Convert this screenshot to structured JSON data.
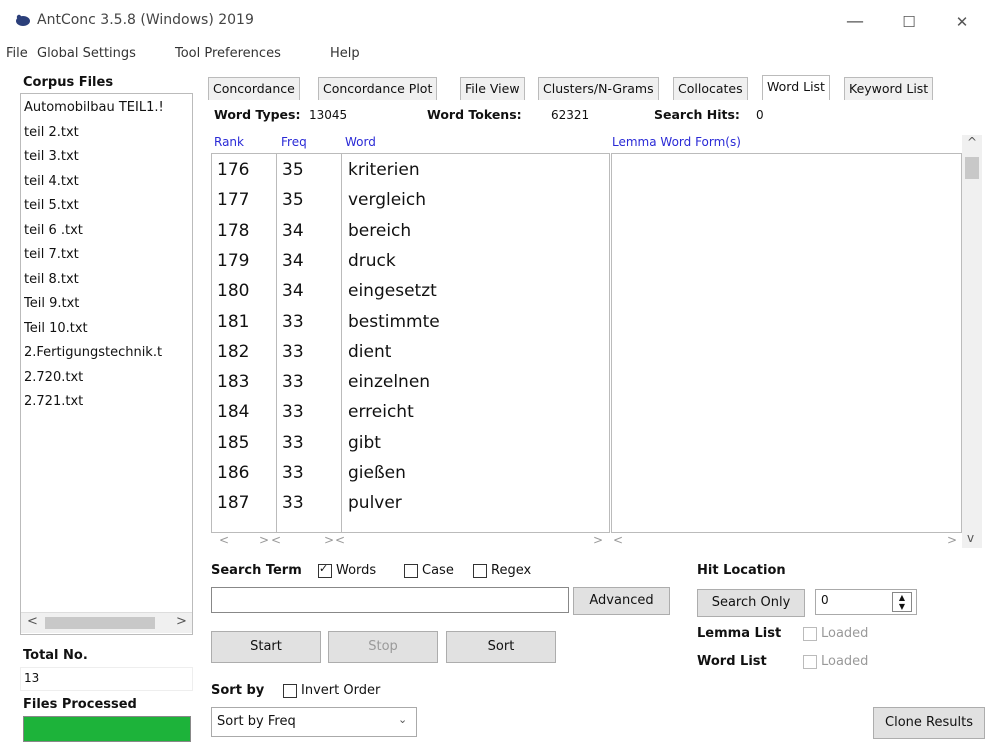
{
  "window": {
    "title": "AntConc 3.5.8 (Windows) 2019",
    "minimize": "—",
    "maximize": "☐",
    "close": "✕"
  },
  "menu": [
    "File",
    "Global Settings",
    "Tool Preferences",
    "Help"
  ],
  "sidebar": {
    "corpus_files_label": "Corpus Files",
    "files": [
      "Automobilbau TEIL1.!",
      "teil 2.txt",
      "teil 3.txt",
      "teil 4.txt",
      "teil 5.txt",
      "teil 6 .txt",
      "teil 7.txt",
      "teil 8.txt",
      "Teil 9.txt",
      "Teil 10.txt",
      "2.Fertigungstechnik.t",
      "2.720.txt",
      "2.721.txt"
    ],
    "total_no_label": "Total No.",
    "total_no_value": "13",
    "files_processed_label": "Files Processed",
    "progress": 1.0
  },
  "tabs": [
    "Concordance",
    "Concordance Plot",
    "File View",
    "Clusters/N-Grams",
    "Collocates",
    "Word List",
    "Keyword List"
  ],
  "active_tab": "Word List",
  "stats": {
    "word_types_label": "Word Types:",
    "word_types_value": "13045",
    "word_tokens_label": "Word Tokens:",
    "word_tokens_value": "62321",
    "search_hits_label": "Search Hits:",
    "search_hits_value": "0"
  },
  "columns": {
    "rank": "Rank",
    "freq": "Freq",
    "word": "Word",
    "lemma": "Lemma Word Form(s)"
  },
  "rows": [
    {
      "rank": "176",
      "freq": "35",
      "word": "kriterien"
    },
    {
      "rank": "177",
      "freq": "35",
      "word": "vergleich"
    },
    {
      "rank": "178",
      "freq": "34",
      "word": "bereich"
    },
    {
      "rank": "179",
      "freq": "34",
      "word": "druck"
    },
    {
      "rank": "180",
      "freq": "34",
      "word": "eingesetzt"
    },
    {
      "rank": "181",
      "freq": "33",
      "word": "bestimmte"
    },
    {
      "rank": "182",
      "freq": "33",
      "word": "dient"
    },
    {
      "rank": "183",
      "freq": "33",
      "word": "einzelnen"
    },
    {
      "rank": "184",
      "freq": "33",
      "word": "erreicht"
    },
    {
      "rank": "185",
      "freq": "33",
      "word": "gibt"
    },
    {
      "rank": "186",
      "freq": "33",
      "word": "gießen"
    },
    {
      "rank": "187",
      "freq": "33",
      "word": "pulver"
    }
  ],
  "search": {
    "search_term_label": "Search Term",
    "words_label": "Words",
    "words_checked": true,
    "case_label": "Case",
    "case_checked": false,
    "regex_label": "Regex",
    "regex_checked": false,
    "input_value": "",
    "advanced_label": "Advanced"
  },
  "hit_location": {
    "label": "Hit Location",
    "search_only_label": "Search Only",
    "spinner_value": "0"
  },
  "controls": {
    "start": "Start",
    "stop": "Stop",
    "sort": "Sort"
  },
  "lemma_list": {
    "label": "Lemma List",
    "loaded": "Loaded"
  },
  "word_list": {
    "label": "Word List",
    "loaded": "Loaded"
  },
  "sort_by": {
    "label": "Sort by",
    "invert_label": "Invert Order",
    "selected": "Sort by Freq"
  },
  "clone_results": "Clone Results",
  "colors": {
    "accent_blue": "#2a2ad6",
    "progress_green": "#1db33a"
  }
}
